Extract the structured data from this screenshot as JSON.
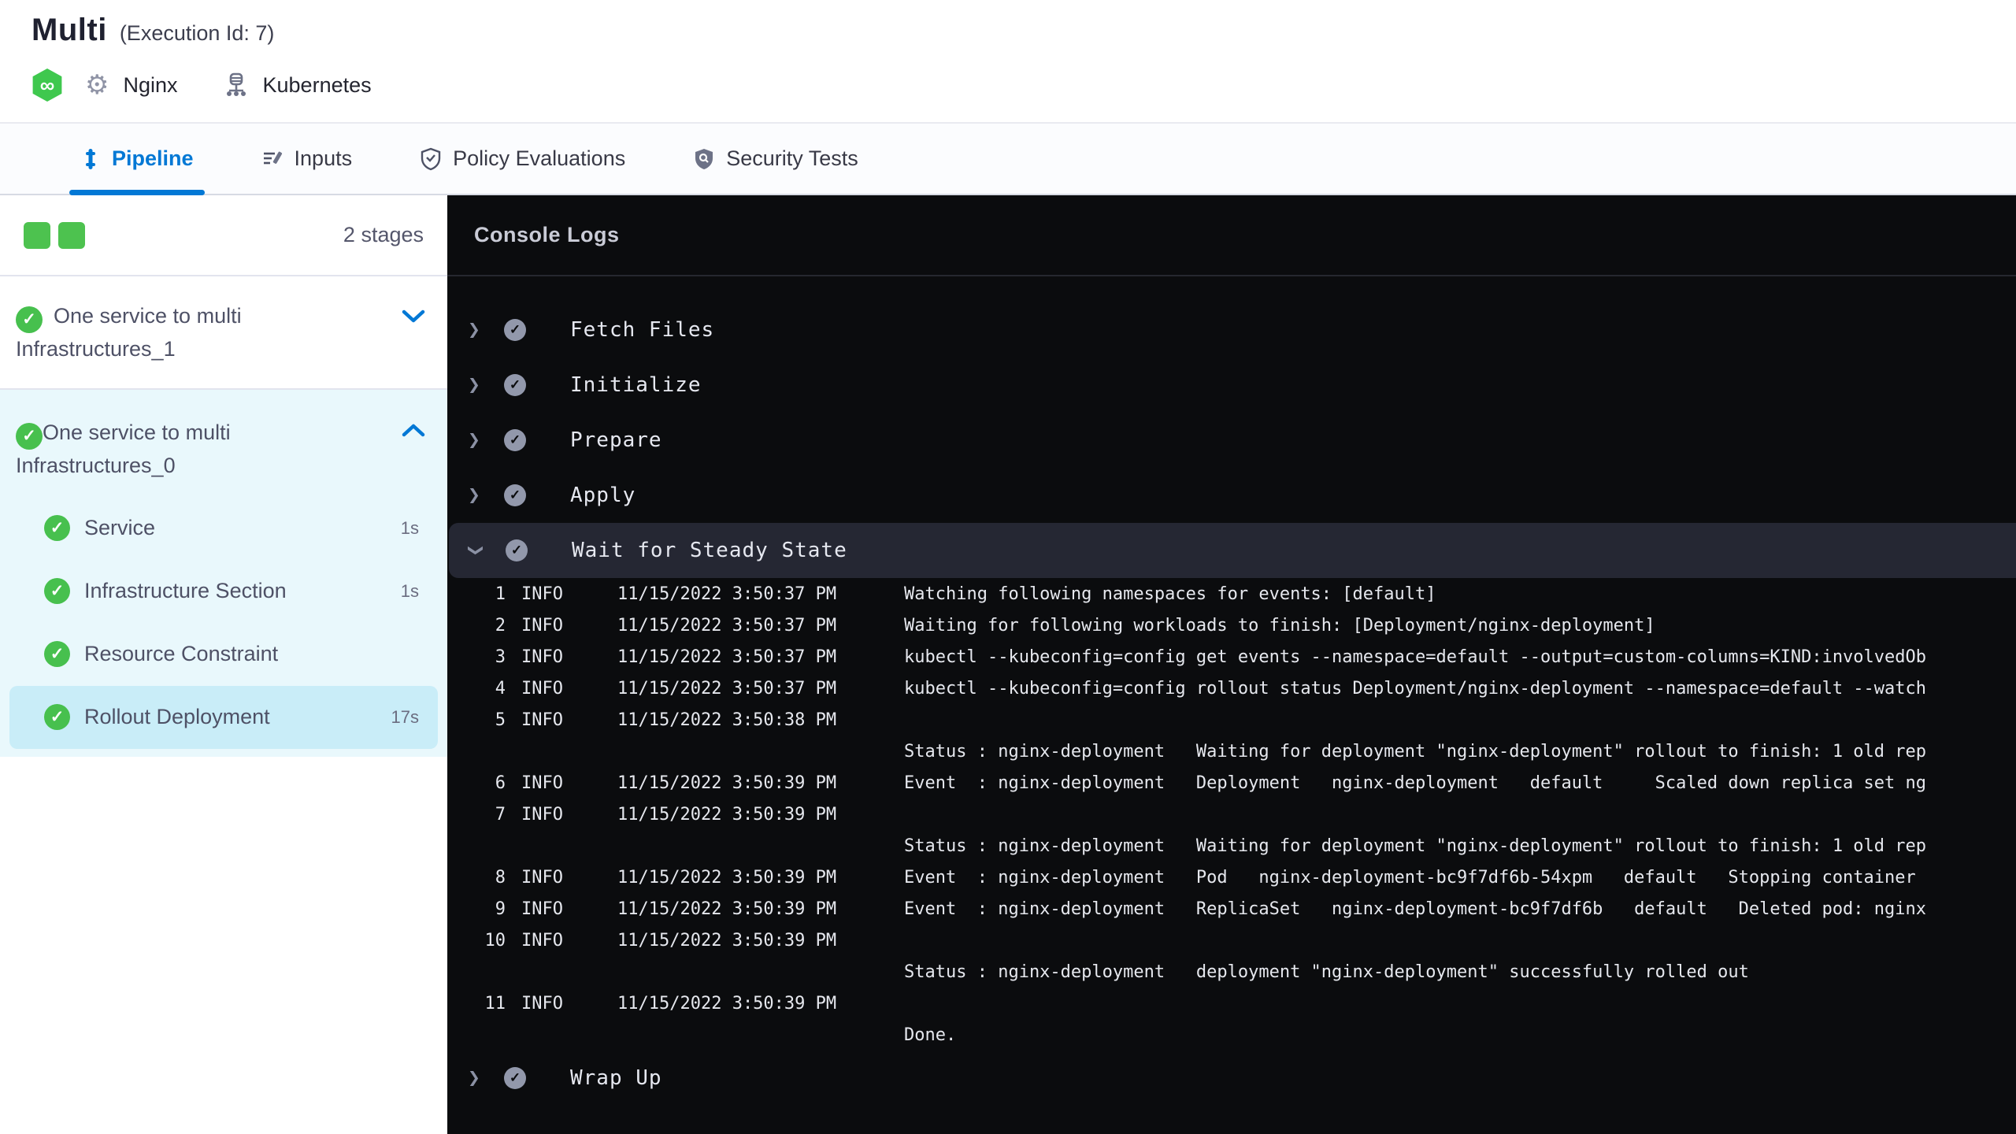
{
  "header": {
    "title": "Multi",
    "execution_id": "(Execution Id: 7)",
    "service_label": "Nginx",
    "infra_label": "Kubernetes"
  },
  "tabs": [
    {
      "label": "Pipeline",
      "active": true
    },
    {
      "label": "Inputs",
      "active": false
    },
    {
      "label": "Policy Evaluations",
      "active": false
    },
    {
      "label": "Security Tests",
      "active": false
    }
  ],
  "sidebar": {
    "stage_count": "2 stages",
    "stages": [
      {
        "name": "One service to multi Infrastructures_1",
        "state": "collapsed"
      },
      {
        "name": "One service to multi Infrastructures_0",
        "state": "expanded",
        "steps": [
          {
            "name": "Service",
            "duration": "1s",
            "selected": false
          },
          {
            "name": "Infrastructure Section",
            "duration": "1s",
            "selected": false
          },
          {
            "name": "Resource Constraint",
            "duration": "",
            "selected": false
          },
          {
            "name": "Rollout Deployment",
            "duration": "17s",
            "selected": true
          }
        ]
      }
    ]
  },
  "console": {
    "title": "Console Logs",
    "steps_before": [
      "Fetch Files",
      "Initialize",
      "Prepare",
      "Apply"
    ],
    "expanded_step": "Wait for Steady State",
    "steps_after": [
      "Wrap Up"
    ],
    "log_lines": [
      {
        "num": "1",
        "level": "INFO",
        "time": "11/15/2022 3:50:37 PM",
        "msg": "Watching following namespaces for events: [default]"
      },
      {
        "num": "2",
        "level": "INFO",
        "time": "11/15/2022 3:50:37 PM",
        "msg": "Waiting for following workloads to finish: [Deployment/nginx-deployment]"
      },
      {
        "num": "3",
        "level": "INFO",
        "time": "11/15/2022 3:50:37 PM",
        "msg": "kubectl --kubeconfig=config get events --namespace=default --output=custom-columns=KIND:involvedOb"
      },
      {
        "num": "4",
        "level": "INFO",
        "time": "11/15/2022 3:50:37 PM",
        "msg": "kubectl --kubeconfig=config rollout status Deployment/nginx-deployment --namespace=default --watch"
      },
      {
        "num": "5",
        "level": "INFO",
        "time": "11/15/2022 3:50:38 PM",
        "msg": ""
      },
      {
        "num": "",
        "level": "",
        "time": "",
        "msg": "Status : nginx-deployment   Waiting for deployment \"nginx-deployment\" rollout to finish: 1 old rep"
      },
      {
        "num": "6",
        "level": "INFO",
        "time": "11/15/2022 3:50:39 PM",
        "msg": "Event  : nginx-deployment   Deployment   nginx-deployment   default     Scaled down replica set ng"
      },
      {
        "num": "7",
        "level": "INFO",
        "time": "11/15/2022 3:50:39 PM",
        "msg": ""
      },
      {
        "num": "",
        "level": "",
        "time": "",
        "msg": "Status : nginx-deployment   Waiting for deployment \"nginx-deployment\" rollout to finish: 1 old rep"
      },
      {
        "num": "8",
        "level": "INFO",
        "time": "11/15/2022 3:50:39 PM",
        "msg": "Event  : nginx-deployment   Pod   nginx-deployment-bc9f7df6b-54xpm   default   Stopping container"
      },
      {
        "num": "9",
        "level": "INFO",
        "time": "11/15/2022 3:50:39 PM",
        "msg": "Event  : nginx-deployment   ReplicaSet   nginx-deployment-bc9f7df6b   default   Deleted pod: nginx"
      },
      {
        "num": "10",
        "level": "INFO",
        "time": "11/15/2022 3:50:39 PM",
        "msg": ""
      },
      {
        "num": "",
        "level": "",
        "time": "",
        "msg": "Status : nginx-deployment   deployment \"nginx-deployment\" successfully rolled out"
      },
      {
        "num": "11",
        "level": "INFO",
        "time": "11/15/2022 3:50:39 PM",
        "msg": ""
      },
      {
        "num": "",
        "level": "",
        "time": "",
        "msg": "Done."
      }
    ]
  },
  "colors": {
    "accent_blue": "#0278d5",
    "success_green": "#4dc24f",
    "console_bg": "#0b0c0e",
    "expanded_stage_bg": "#e9f8fc",
    "selected_step_bg": "#c9edf8",
    "expanded_console_row_bg": "#252733"
  }
}
